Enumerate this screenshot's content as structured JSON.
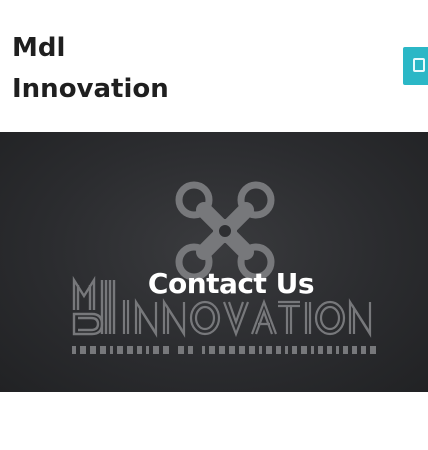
{
  "header": {
    "site_title_line1": "Mdl",
    "site_title_line2": "Innovation",
    "menu_toggle_icon": "menu-icon"
  },
  "hero": {
    "title": "Contact Us",
    "logo": {
      "wordmark": "INNOVATION",
      "tagline": "IMAGINATION OF IMPOSSIBLITIES"
    }
  },
  "colors": {
    "accent": "#2bb7c6",
    "hero_background": "#2d2e31",
    "logo_gray": "#77787b",
    "title_text": "#1f1f1f"
  }
}
